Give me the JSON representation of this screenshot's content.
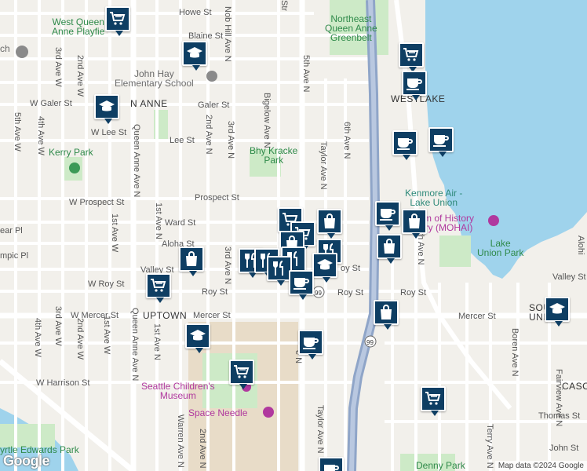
{
  "colors": {
    "marker": "#0e3e63",
    "water": "#9fd3ec",
    "park": "#cdeac7",
    "highway": "#8fa5c8",
    "land": "#f2f0eb"
  },
  "labels": {
    "howe_st": "Howe St",
    "blaine_st": "Blaine St",
    "galer_st_w": "W Galer St",
    "galer_st": "Galer St",
    "lee_st_w": "W Lee St",
    "lee_st": "Lee St",
    "prospect_st_w": "W Prospect St",
    "prospect_st": "Prospect St",
    "ward_st": "Ward St",
    "aloha_st": "Aloha St",
    "valley_st": "Valley St",
    "valley_st_east": "Valley St",
    "roy_st_w": "W Roy St",
    "roy_st": "Roy St",
    "roy_st_b": "Roy St",
    "roy_st_c": "Roy St",
    "roy_st_partial": "oy St",
    "mercer_st_w": "W Mercer St",
    "mercer_st": "Mercer St",
    "mercer_st_east": "Mercer St",
    "harrison_st_w": "W Harrison St",
    "thomas_st": "Thomas St",
    "john_st": "John St",
    "avenue_3rd_w": "3rd Ave W",
    "avenue_3rd_w_b": "3rd Ave W",
    "avenue_2nd_w": "2nd Ave W",
    "avenue_2nd_w_b": "2nd Ave W",
    "avenue_4th_w": "4th Ave W",
    "avenue_4th_w_b": "4th Ave W",
    "avenue_5th_w": "5th Ave W",
    "avenue_1st_w": "1st Ave W",
    "avenue_1st_w_b": "1st Ave W",
    "avenue_1st_n": "1st Ave N",
    "avenue_1st_n_b": "1st Ave N",
    "queen_anne_ave": "Queen Anne Ave N",
    "queen_anne_ave_b": "Queen Anne Ave N",
    "nob_hill": "Nob Hill Ave N",
    "avenue_2nd_n": "2nd Ave N",
    "avenue_2nd_n_b": "2nd Ave N",
    "avenue_3rd_n": "3rd Ave N",
    "avenue_3rd_n_b": "3rd Ave N",
    "bigelow": "Bigelow Ave N",
    "avenue_5th_n": "5th Ave N",
    "avenue_5th_n_b": "e N",
    "avenue_6th_n": "6th Ave N",
    "taylor": "Taylor Ave N",
    "taylor_b": "Taylor Ave N",
    "avenue_8th_n": "8th Ave N",
    "boren": "Boren Ave N",
    "fairview": "Fairview Ave N",
    "terry": "Terry Ave N",
    "warren": "Warren Ave N",
    "stone_partial": "Str",
    "west_queen_anne": "West Queen\nAnne Playfie",
    "northeast_greenbelt": "Northeast\nQueen Anne\nGreenbelt",
    "john_hay": "John Hay\nElementary School",
    "queen_anne_district": "N ANNE",
    "westlake": "WESTLAKE",
    "kerry_park": "Kerry Park",
    "bhy_kracke": "Bhy Kracke\nPark",
    "kenmore": "Kenmore Air -\nLake Union",
    "mohai": "m of History\nry (MOHAI)",
    "lake_union_park": "Lake\nUnion Park",
    "uptown": "UPTOWN",
    "south_lake_union": "SOUTH\nUNI",
    "childrens_museum": "Seattle Children's\nMuseum",
    "space_needle": "Space Needle",
    "myrtle_edwards": "yrtle Edwards Park",
    "denny_park": "Denny Park",
    "cascade_partial": "CASC",
    "church_partial": "ch",
    "aloha_partial": "Alohi",
    "ear_pl": "ear Pl",
    "ympic_pl": "mpic Pl",
    "hwy_99": "99",
    "hwy_99_b": "99"
  },
  "google_logo": "Google",
  "attribution": "Map data ©2024 Google",
  "markers": [
    {
      "icon": "grocery-icon"
    },
    {
      "icon": "school-icon"
    },
    {
      "icon": "grocery-icon"
    },
    {
      "icon": "coffee-icon"
    },
    {
      "icon": "school-icon"
    },
    {
      "icon": "coffee-icon"
    },
    {
      "icon": "coffee-icon"
    },
    {
      "icon": "coffee-icon"
    },
    {
      "icon": "shopping-bag-icon"
    },
    {
      "icon": "shopping-bag-icon"
    },
    {
      "icon": "shopping-bag-icon"
    },
    {
      "icon": "grocery-icon"
    },
    {
      "icon": "restaurant-icon"
    },
    {
      "icon": "restaurant-icon"
    },
    {
      "icon": "restaurant-icon"
    },
    {
      "icon": "coffee-icon"
    },
    {
      "icon": "shopping-bag-icon"
    },
    {
      "icon": "school-icon"
    },
    {
      "icon": "coffee-icon"
    },
    {
      "icon": "grocery-icon"
    },
    {
      "icon": "grocery-icon"
    },
    {
      "icon": "school-icon"
    },
    {
      "icon": "coffee-icon"
    }
  ]
}
